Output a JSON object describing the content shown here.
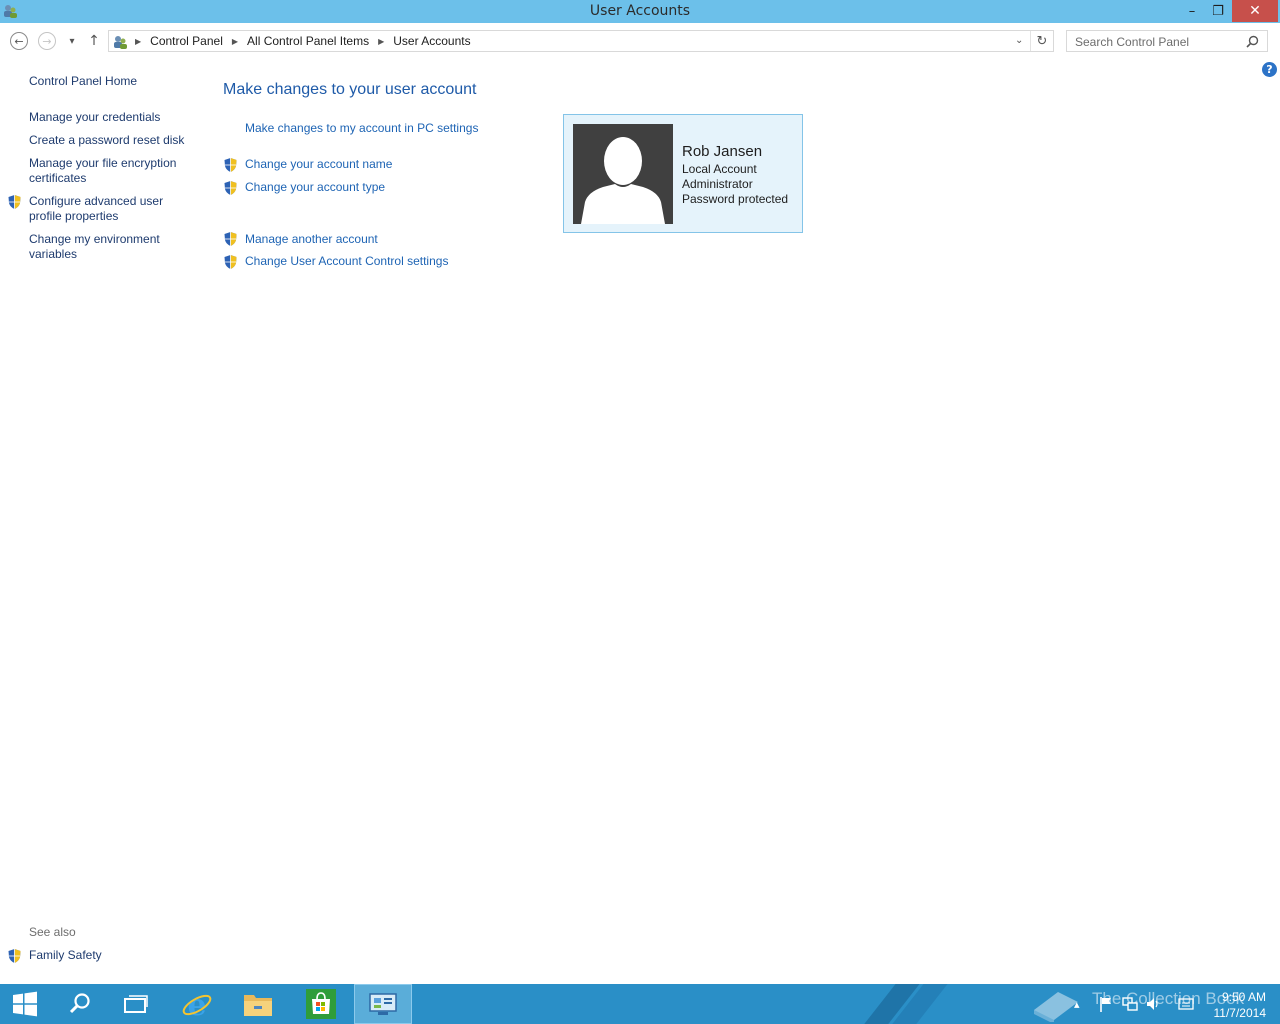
{
  "window": {
    "title": "User Accounts",
    "controls": {
      "minimize": "–",
      "restore": "❐",
      "close": "✕"
    }
  },
  "navigation": {
    "back_icon": "←",
    "forward_icon": "→",
    "recent_icon": "▾",
    "up_icon": "↑",
    "breadcrumbs": [
      "Control Panel",
      "All Control Panel Items",
      "User Accounts"
    ],
    "separator": "▶",
    "dropdown_icon": "⌄",
    "refresh_icon": "↻",
    "search_placeholder": "Search Control Panel"
  },
  "help_label": "?",
  "sidebar": {
    "home": "Control Panel Home",
    "items": [
      "Manage your credentials",
      "Create a password reset disk",
      "Manage your file encryption certificates",
      "Configure advanced user profile properties",
      "Change my environment variables"
    ],
    "item_lines": {
      "encryption": [
        "Manage your file encryption",
        "certificates"
      ],
      "profile": [
        "Configure advanced user",
        "profile properties"
      ],
      "environment": [
        "Change my environment",
        "variables"
      ]
    },
    "see_also_label": "See also",
    "see_also_items": [
      "Family Safety"
    ]
  },
  "main": {
    "heading": "Make changes to your user account",
    "tasks": [
      "Make changes to my account in PC settings",
      "Change your account name",
      "Change your account type",
      "Manage another account",
      "Change User Account Control settings"
    ]
  },
  "account": {
    "name": "Rob Jansen",
    "type": "Local Account",
    "role": "Administrator",
    "security": "Password protected"
  },
  "taskbar": {
    "watermark": "The Collection Book",
    "time": "9:50 AM",
    "date": "11/7/2014",
    "tray_chevron": "▴"
  },
  "colors": {
    "titlebar": "#6cc0ea",
    "taskbar": "#2a8fc7",
    "link": "#1e64b4",
    "heading": "#1e5aa8",
    "tile_bg": "#e5f3fb",
    "tile_border": "#84c4e8",
    "close_button": "#c7504b"
  }
}
